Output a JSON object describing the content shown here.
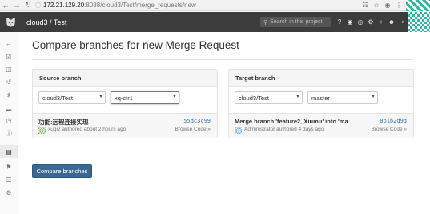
{
  "browser": {
    "back_icon": "back-arrow-icon",
    "forward_icon": "forward-arrow-icon",
    "reload_icon": "reload-icon",
    "url_host": "172.21.129.20",
    "url_path": ":8088/cloud3/Test/merge_requests/new"
  },
  "header": {
    "title": "cloud3 / Test",
    "search_placeholder": "Search in this project"
  },
  "page": {
    "title": "Compare branches for new Merge Request"
  },
  "source": {
    "heading": "Source branch",
    "project": "cloud3/Test",
    "branch": "xq-ctr1",
    "commit_message": "功能:远程连接实现",
    "commit_sha": "55dc3c99",
    "commit_meta": "xuqi2 authored about 2 hours ago",
    "browse_label": "Browse Code »"
  },
  "target": {
    "heading": "Target branch",
    "project": "cloud3/Test",
    "branch": "master",
    "commit_message": "Merge branch 'feature2_Xiumu' into 'ma...",
    "commit_sha": "0b1b2d9d",
    "commit_meta": "Administrator authored 4 days ago",
    "browse_label": "Browse Code »"
  },
  "actions": {
    "compare_label": "Compare branches"
  },
  "colors": {
    "header_bg": "#3c3c3c",
    "primary_button": "#3b6893",
    "sha_link": "#3777b0"
  }
}
